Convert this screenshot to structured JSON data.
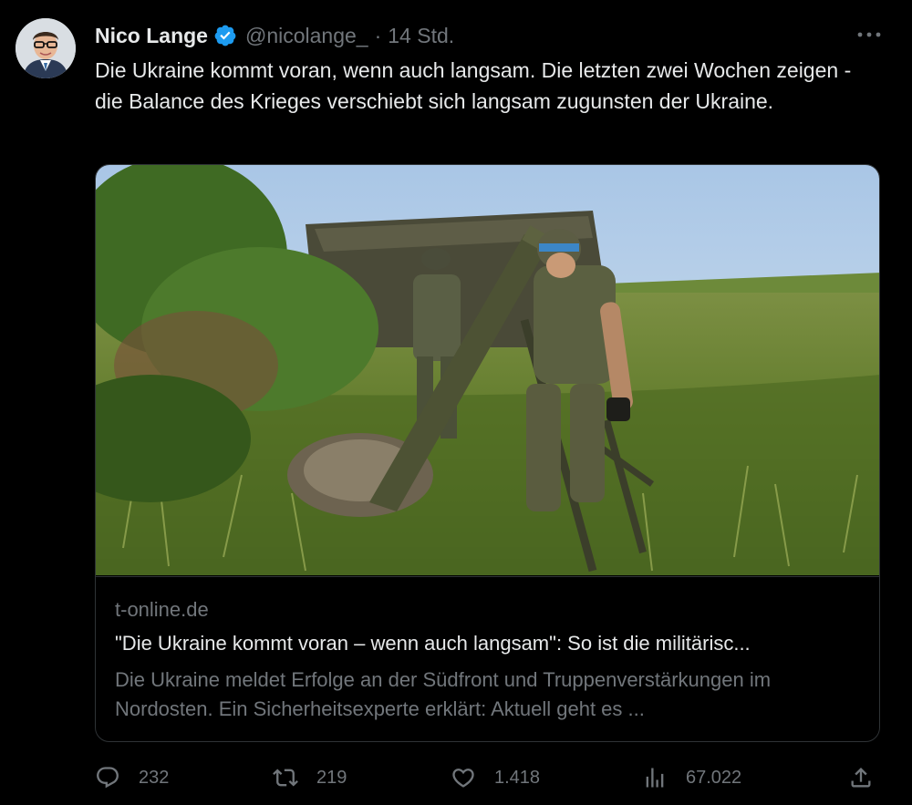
{
  "author": {
    "name": "Nico Lange",
    "handle": "@nicolange_",
    "separator": "·",
    "time": "14 Std.",
    "verified": true,
    "badge_color": "#1d9bf0"
  },
  "tweet": {
    "text": "Die Ukraine kommt voran, wenn auch langsam. Die letzten zwei Wochen zeigen - die Balance des Krieges verschiebt sich langsam zugunsten der Ukraine."
  },
  "card": {
    "domain": "t-online.de",
    "title": "\"Die Ukraine kommt voran – wenn auch langsam\": So ist die militärisc...",
    "description": "Die Ukraine meldet Erfolge an der Südfront und Truppenverstärkungen im Nordosten. Ein Sicherheitsexperte erklärt: Aktuell geht es ..."
  },
  "actions": {
    "replies": "232",
    "retweets": "219",
    "likes": "1.418",
    "views": "67.022"
  },
  "icons": {
    "more": "more-options-icon",
    "reply": "reply-icon",
    "retweet": "retweet-icon",
    "like": "heart-icon",
    "views": "views-chart-icon",
    "share": "share-icon"
  }
}
